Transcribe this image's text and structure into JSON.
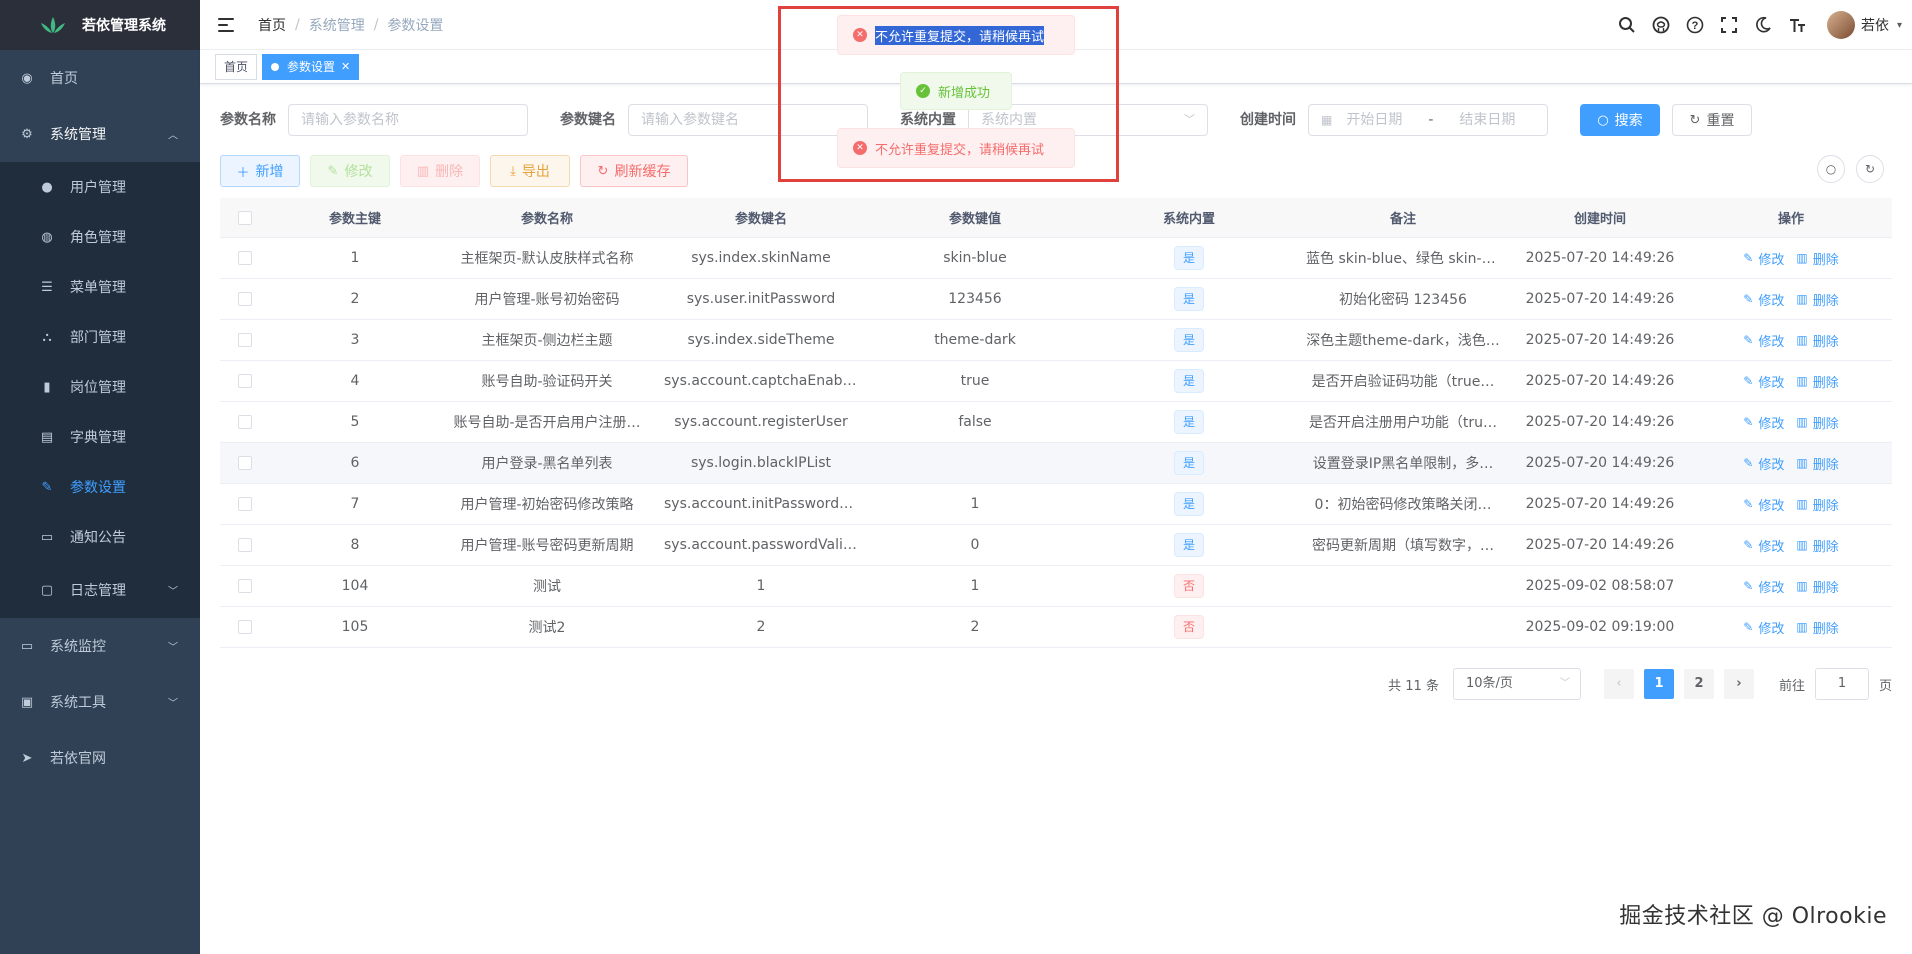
{
  "app": {
    "title": "若依管理系统"
  },
  "sidebar": {
    "home": "首页",
    "system": "系统管理",
    "system_items": [
      {
        "label": "用户管理",
        "icon": "user-icon"
      },
      {
        "label": "角色管理",
        "icon": "peoples-icon"
      },
      {
        "label": "菜单管理",
        "icon": "tree-table-icon"
      },
      {
        "label": "部门管理",
        "icon": "tree-icon"
      },
      {
        "label": "岗位管理",
        "icon": "post-icon"
      },
      {
        "label": "字典管理",
        "icon": "dict-icon"
      },
      {
        "label": "参数设置",
        "icon": "edit-icon"
      },
      {
        "label": "通知公告",
        "icon": "message-icon"
      },
      {
        "label": "日志管理",
        "icon": "log-icon"
      }
    ],
    "monitor": "系统监控",
    "tool": "系统工具",
    "site": "若依官网"
  },
  "navbar": {
    "breadcrumb": [
      "首页",
      "系统管理",
      "参数设置"
    ],
    "username": "若依"
  },
  "tags": {
    "home": "首页",
    "active": "参数设置"
  },
  "search": {
    "config_name_label": "参数名称",
    "config_name_placeholder": "请输入参数名称",
    "config_key_label": "参数键名",
    "config_key_placeholder": "请输入参数键名",
    "config_type_label": "系统内置",
    "config_type_placeholder": "系统内置",
    "date_label": "创建时间",
    "start_placeholder": "开始日期",
    "range_sep": "-",
    "end_placeholder": "结束日期",
    "search_btn": "搜索",
    "reset_btn": "重置"
  },
  "toolbar": {
    "add": "新增",
    "edit": "修改",
    "delete": "删除",
    "export": "导出",
    "refresh_cache": "刷新缓存"
  },
  "table": {
    "headers": [
      "参数主键",
      "参数名称",
      "参数键名",
      "参数键值",
      "系统内置",
      "备注",
      "创建时间",
      "操作"
    ],
    "rows": [
      {
        "id": "1",
        "name": "主框架页-默认皮肤样式名称",
        "key": "sys.index.skinName",
        "value": "skin-blue",
        "builtin": "是",
        "remark": "蓝色 skin-blue、绿色 skin-g…",
        "time": "2025-07-20 14:49:26"
      },
      {
        "id": "2",
        "name": "用户管理-账号初始密码",
        "key": "sys.user.initPassword",
        "value": "123456",
        "builtin": "是",
        "remark": "初始化密码 123456",
        "time": "2025-07-20 14:49:26"
      },
      {
        "id": "3",
        "name": "主框架页-侧边栏主题",
        "key": "sys.index.sideTheme",
        "value": "theme-dark",
        "builtin": "是",
        "remark": "深色主题theme-dark，浅色…",
        "time": "2025-07-20 14:49:26"
      },
      {
        "id": "4",
        "name": "账号自助-验证码开关",
        "key": "sys.account.captchaEnabled",
        "value": "true",
        "builtin": "是",
        "remark": "是否开启验证码功能（true…",
        "time": "2025-07-20 14:49:26"
      },
      {
        "id": "5",
        "name": "账号自助-是否开启用户注册…",
        "key": "sys.account.registerUser",
        "value": "false",
        "builtin": "是",
        "remark": "是否开启注册用户功能（tru…",
        "time": "2025-07-20 14:49:26"
      },
      {
        "id": "6",
        "name": "用户登录-黑名单列表",
        "key": "sys.login.blackIPList",
        "value": "",
        "builtin": "是",
        "remark": "设置登录IP黑名单限制，多…",
        "time": "2025-07-20 14:49:26"
      },
      {
        "id": "7",
        "name": "用户管理-初始密码修改策略",
        "key": "sys.account.initPasswordM…",
        "value": "1",
        "builtin": "是",
        "remark": "0：初始密码修改策略关闭…",
        "time": "2025-07-20 14:49:26"
      },
      {
        "id": "8",
        "name": "用户管理-账号密码更新周期",
        "key": "sys.account.passwordValid…",
        "value": "0",
        "builtin": "是",
        "remark": "密码更新周期（填写数字，…",
        "time": "2025-07-20 14:49:26"
      },
      {
        "id": "104",
        "name": "测试",
        "key": "1",
        "value": "1",
        "builtin": "否",
        "remark": "",
        "time": "2025-09-02 08:58:07"
      },
      {
        "id": "105",
        "name": "测试2",
        "key": "2",
        "value": "2",
        "builtin": "否",
        "remark": "",
        "time": "2025-09-02 09:19:00"
      }
    ],
    "edit_label": "修改",
    "delete_label": "删除"
  },
  "pagination": {
    "total": "共 11 条",
    "page_size": "10条/页",
    "pages": [
      "1",
      "2"
    ],
    "current": "1",
    "goto_label": "前往",
    "goto_value": "1",
    "page_suffix": "页"
  },
  "messages": {
    "error1": "不允许重复提交，请稍候再试",
    "success": "新增成功",
    "error2": "不允许重复提交，请稍候再试"
  },
  "watermark": "掘金技术社区 @ Olrookie",
  "colors": {
    "primary": "#409eff",
    "sidebar": "#304156",
    "error": "#f56c6c",
    "success": "#67c23a",
    "highlight": "#e0413a"
  }
}
